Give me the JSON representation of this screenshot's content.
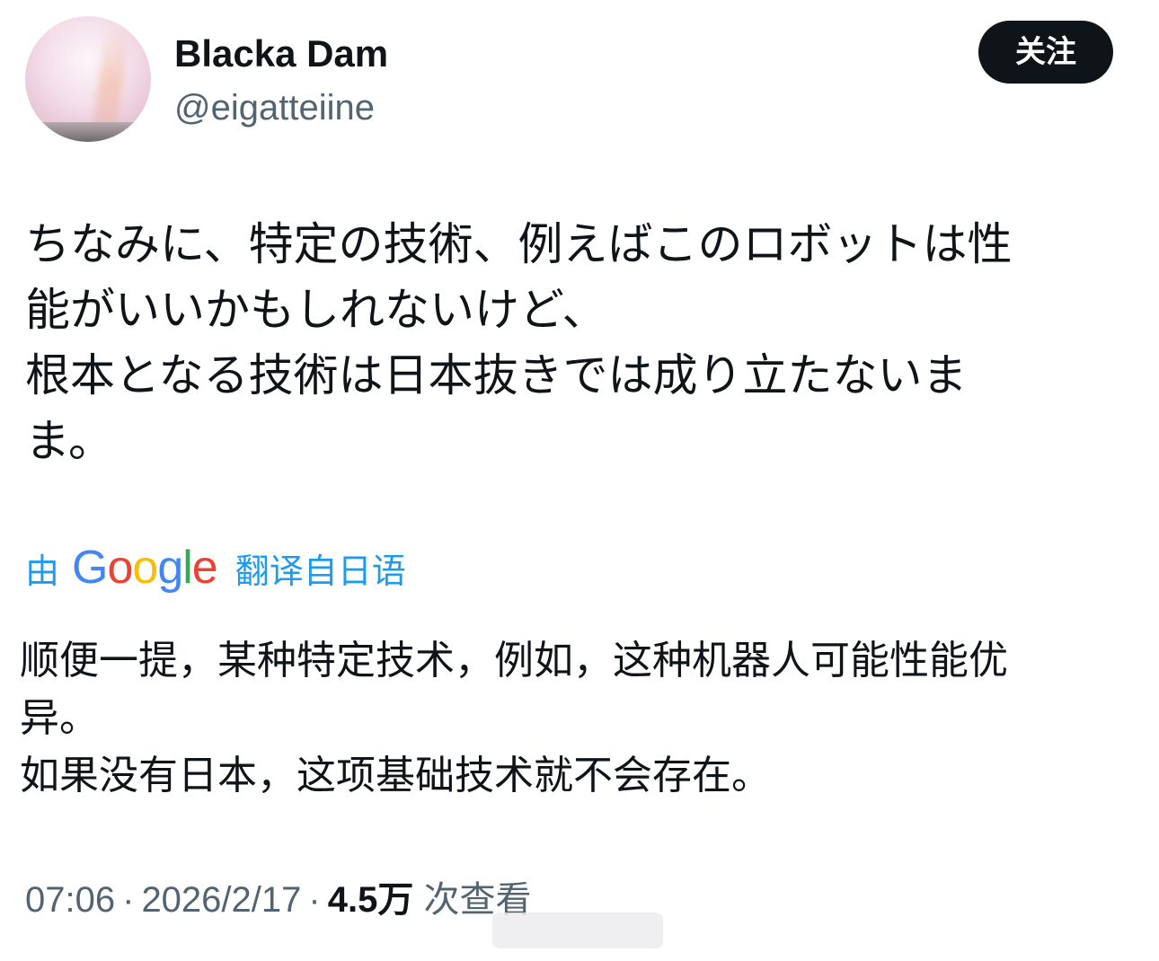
{
  "author": {
    "display_name": "Blacka Dam",
    "handle": "@eigatteiine"
  },
  "follow_button": {
    "label": "关注"
  },
  "tweet": {
    "text": "ちなみに、特定の技術、例えばこのロボットは性\n能がいいかもしれないけど、\n根本となる技術は日本抜きでは成り立たないま\nま。"
  },
  "translation": {
    "prefix": "由",
    "provider_letters": [
      "G",
      "o",
      "o",
      "g",
      "l",
      "e"
    ],
    "provider_colors": [
      "#4285F4",
      "#EA4335",
      "#FBBC05",
      "#4285F4",
      "#34A853",
      "#EA4335"
    ],
    "suffix": "翻译自日语",
    "text": "顺便一提，某种特定技术，例如，这种机器人可能性能优\n异。\n如果没有日本，这项基础技术就不会存在。"
  },
  "meta": {
    "time": "07:06",
    "separator": "·",
    "date": "2026/2/17",
    "views": "4.5万",
    "views_label": "次查看"
  },
  "colors": {
    "text_primary": "#0f1419",
    "text_secondary": "#536471",
    "link_blue": "#1d9bf0",
    "button_bg": "#0f1419"
  }
}
